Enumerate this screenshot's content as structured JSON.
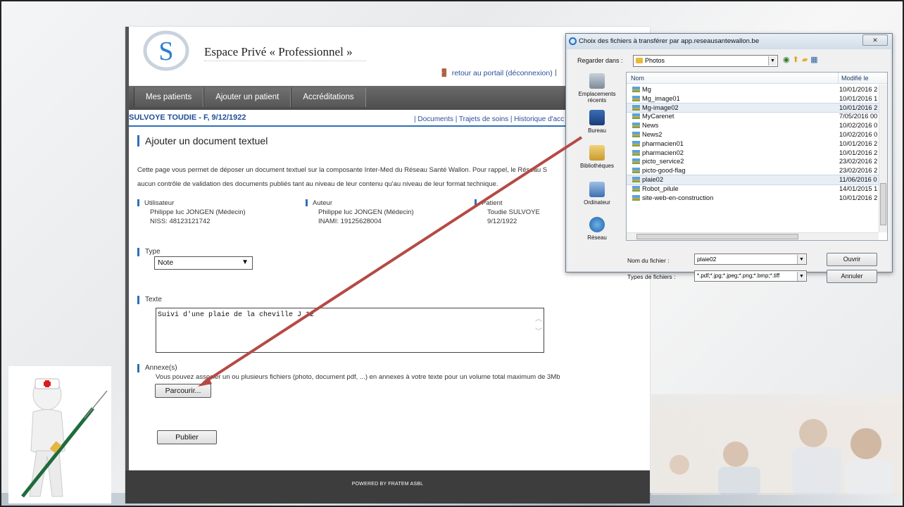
{
  "page": {
    "site_title": "Espace Privé « Professionnel »",
    "portal_link": "retour au portail (déconnexion)",
    "portal_sep": "|",
    "nav": [
      "Mes patients",
      "Ajouter un patient",
      "Accréditations"
    ],
    "patient_header": "SULVOYE TOUDIE - F, 9/12/1922",
    "patient_links": "| Documents | Trajets de soins | Historique d'acc",
    "heading": "Ajouter un document textuel",
    "intro_line1": "Cette page vous permet de déposer un document textuel sur la composante Inter-Med du Réseau Santé Wallon. Pour rappel, le Réseau S",
    "intro_line2": "aucun contrôle de validation des documents publiés tant au niveau de leur contenu qu'au niveau de leur format technique.",
    "user": {
      "label": "Utilisateur",
      "name": "Philippe luc JONGEN (Médecin)",
      "id": "NISS: 48123121742"
    },
    "author": {
      "label": "Auteur",
      "name": "Philippe luc JONGEN (Médecin)",
      "id": "INAMI: 19125628004"
    },
    "patient": {
      "label": "Patient",
      "name": "Toudie SULVOYE",
      "dob": "9/12/1922"
    },
    "type_label": "Type",
    "type_value": "Note",
    "texte_label": "Texte",
    "texte_value": "Suivi d'une plaie de la cheville J 12",
    "annexe_label": "Annexe(s)",
    "annexe_desc": "Vous pouvez associer un ou plusieurs fichiers (photo, document pdf, ...) en annexes à votre texte pour un volume total maximum de 3Mb",
    "browse_button": "Parcourir...",
    "publish_button": "Publier",
    "footer": "POWERED BY FRATEM ASBL"
  },
  "dialog": {
    "title": "Choix des fichiers à transférer par app.reseausantewallon.be",
    "close": "✕",
    "look_in_label": "Regarder dans :",
    "look_in_value": "Photos",
    "places": [
      "Emplacements récents",
      "Bureau",
      "Bibliothèques",
      "Ordinateur",
      "Réseau"
    ],
    "col_name": "Nom",
    "col_modified": "Modifié le",
    "files": [
      {
        "name": "Mg",
        "date": "10/01/2016 2"
      },
      {
        "name": "Mg_image01",
        "date": "10/01/2016 1"
      },
      {
        "name": "Mg-image02",
        "date": "10/01/2016 2"
      },
      {
        "name": "MyCarenet",
        "date": "7/05/2016 00"
      },
      {
        "name": "News",
        "date": "10/02/2016 0"
      },
      {
        "name": "News2",
        "date": "10/02/2016 0"
      },
      {
        "name": "pharmacien01",
        "date": "10/01/2016 2"
      },
      {
        "name": "pharmacien02",
        "date": "10/01/2016 2"
      },
      {
        "name": "picto_service2",
        "date": "23/02/2016 2"
      },
      {
        "name": "picto-good-flag",
        "date": "23/02/2016 2"
      },
      {
        "name": "plaie02",
        "date": "11/06/2016 0"
      },
      {
        "name": "Robot_pilule",
        "date": "14/01/2015 1"
      },
      {
        "name": "site-web-en-construction",
        "date": "10/01/2016 2"
      }
    ],
    "selected_files": [
      2,
      10
    ],
    "filename_label": "Nom du fichier :",
    "filename_value": "plaie02",
    "filetypes_label": "Types de fichiers :",
    "filetypes_value": "*.pdf;*.jpg;*.jpeg;*.png;*.bmp;*.tiff",
    "open_button": "Ouvrir",
    "cancel_button": "Annuler"
  },
  "colors": {
    "accent_blue": "#2d6fb8",
    "arrow_red": "#b54a45",
    "navbar": "#5a5a5a",
    "footer": "#3d3d3d"
  }
}
